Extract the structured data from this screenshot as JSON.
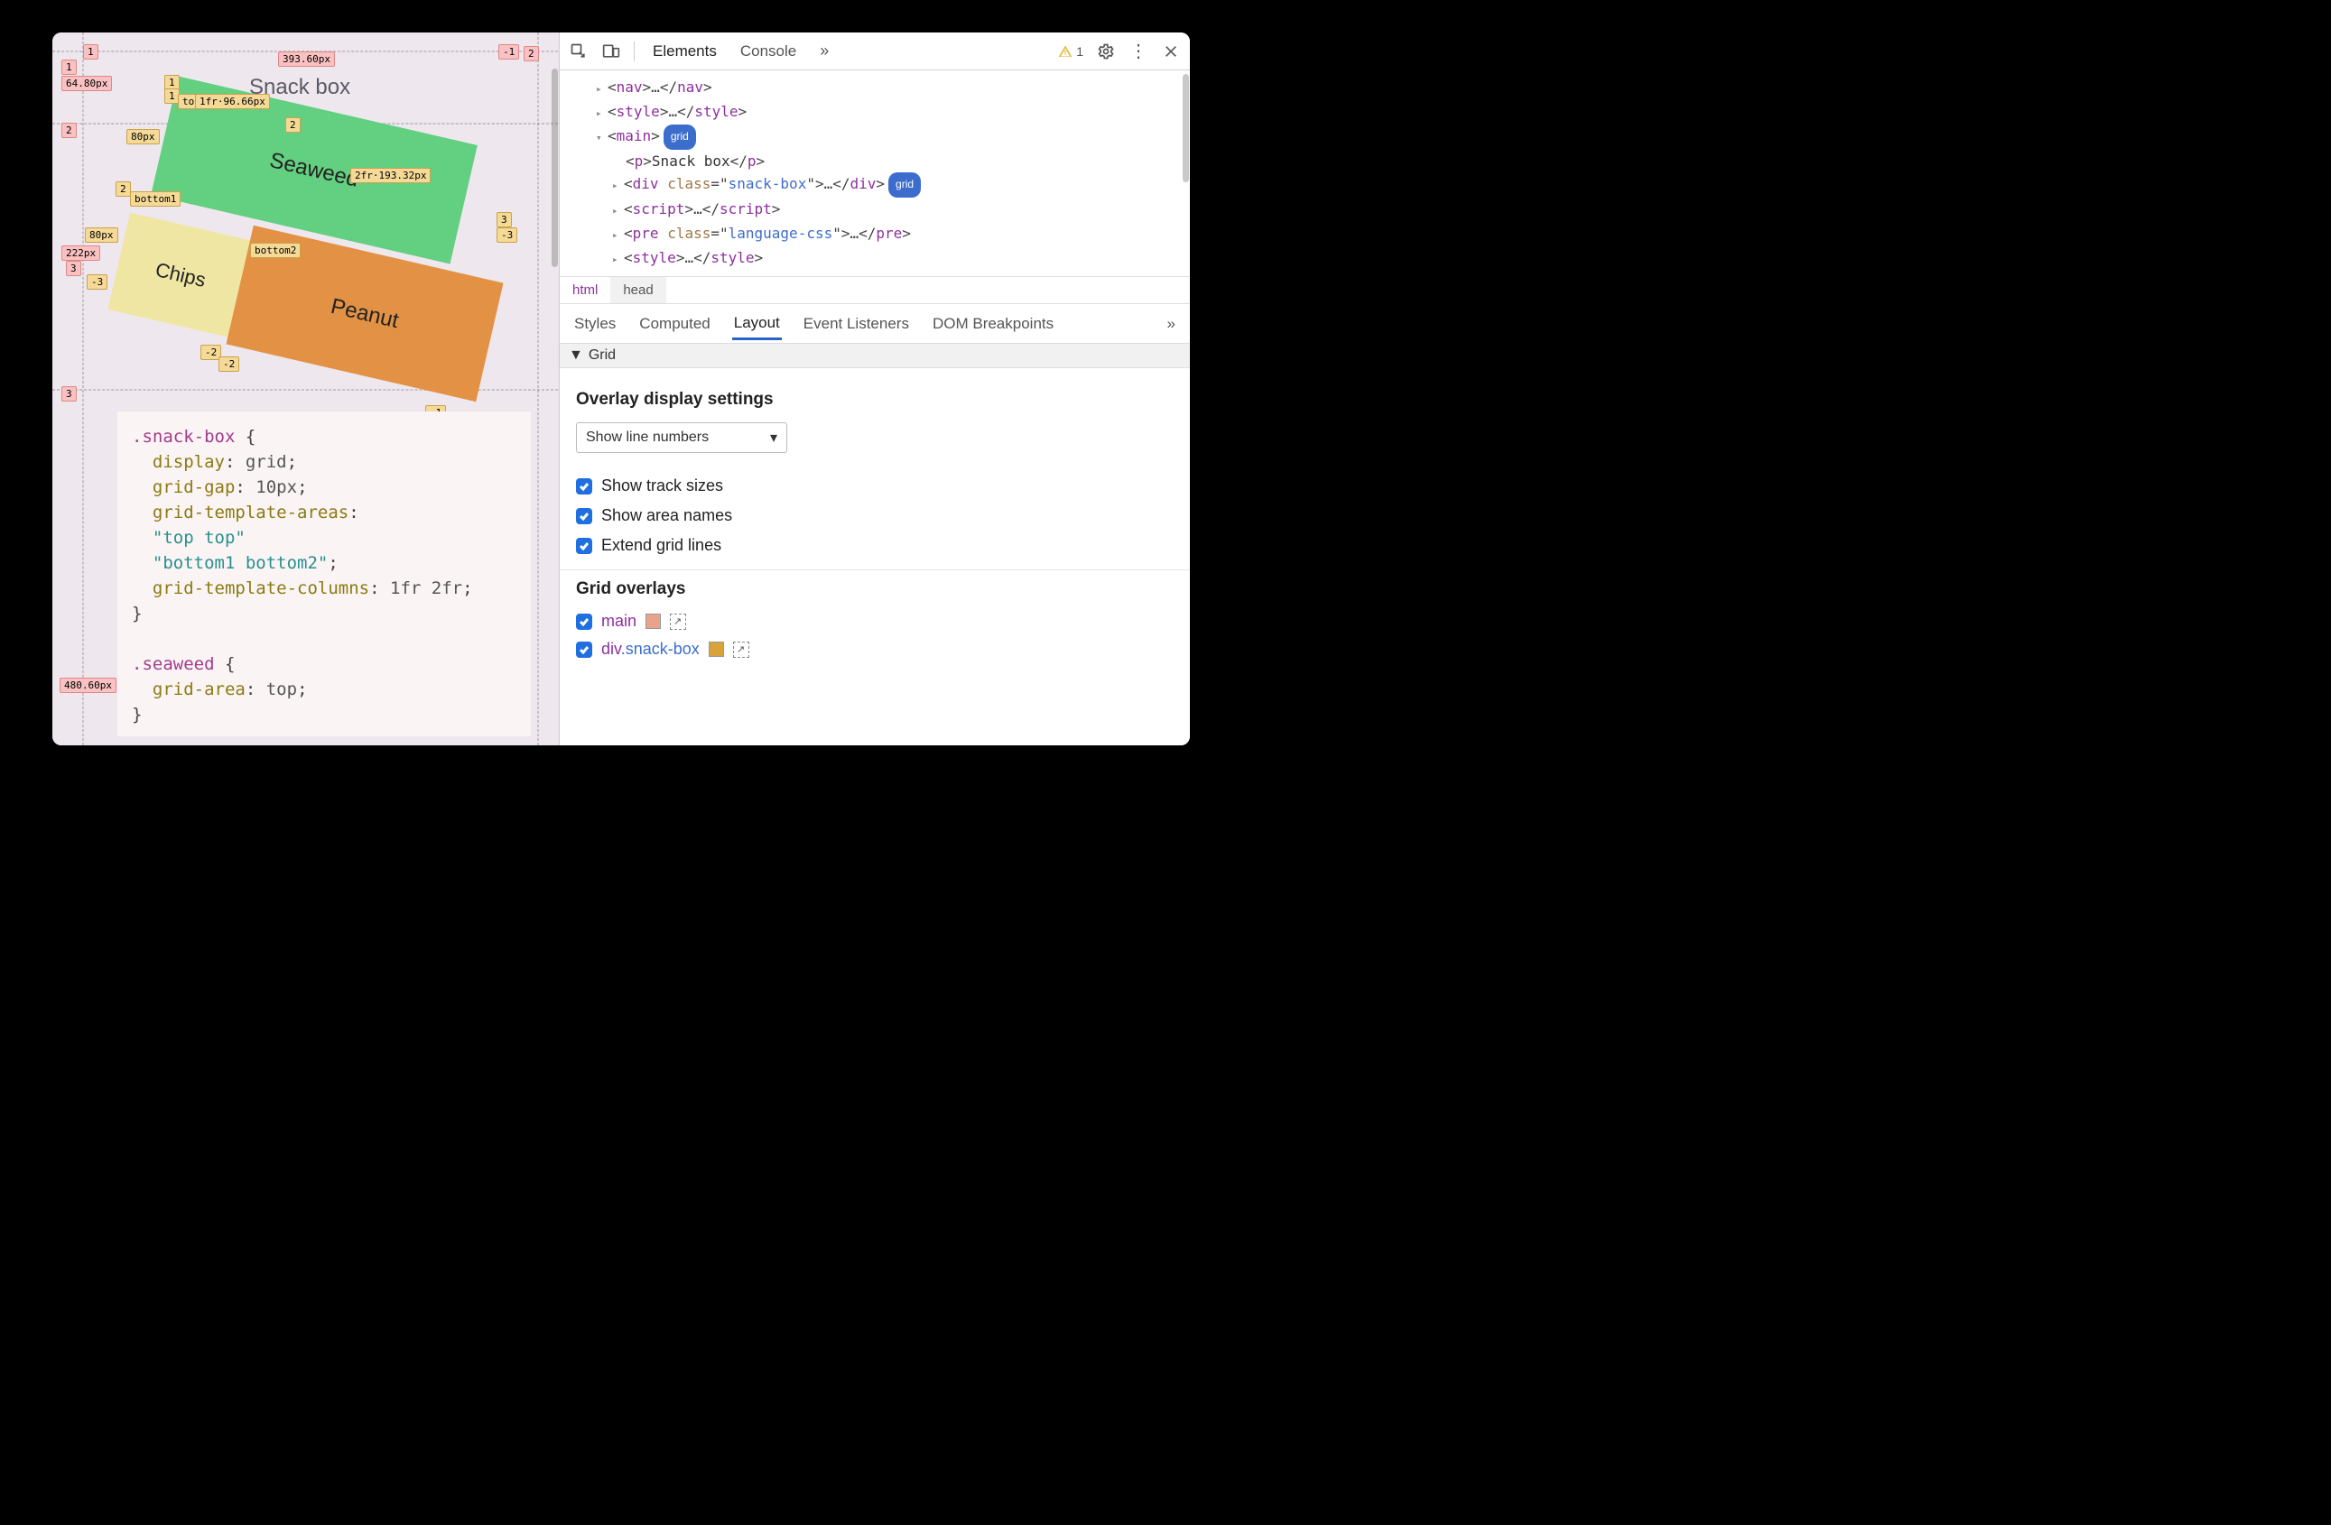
{
  "viewport": {
    "title": "Snack box",
    "boxes": {
      "seaweed": "Seaweed",
      "chips": "Chips",
      "peanut": "Peanut"
    },
    "labels": {
      "top_pink_1": "1",
      "top_px": "393.60px",
      "top_neg1": "-1",
      "top_pink_2": "2",
      "left_pink_1": "1",
      "left_64": "64.80px",
      "left_pink_2": "2",
      "left_80a": "80px",
      "left_pink_neg2a": "2",
      "left_80b": "80px",
      "left_222": "222px",
      "left_pink_3a": "3",
      "left_neg3a": "-3",
      "left_pink_3": "3",
      "left_480": "480.60px",
      "g1a": "1",
      "g1b": "1",
      "toplbl": "top",
      "track1": "1fr·96.66px",
      "g2a": "2",
      "track2": "2fr·193.32px",
      "g3a": "3",
      "neg3b": "-3",
      "bottom1": "bottom1",
      "bottom2": "bottom2",
      "neg2a": "-2",
      "neg2b": "-2",
      "neg1a": "-1",
      "neg1b": "-1"
    },
    "code_lines": [
      {
        "t": "sel",
        "v": ".snack-box"
      },
      {
        "t": "open",
        "v": " {"
      },
      {
        "indent": 1,
        "prop": "display",
        "val": "grid"
      },
      {
        "indent": 1,
        "prop": "grid-gap",
        "val": "10px"
      },
      {
        "indent": 1,
        "prop": "grid-template-areas",
        "val": null
      },
      {
        "indent": 1,
        "str": "\"top top\""
      },
      {
        "indent": 1,
        "str": "\"bottom1 bottom2\"",
        "semi": true
      },
      {
        "indent": 1,
        "prop": "grid-template-columns",
        "val": "1fr 2fr"
      },
      {
        "t": "close",
        "v": "}"
      },
      {
        "blank": true
      },
      {
        "t": "sel",
        "v": ".seaweed"
      },
      {
        "t": "open",
        "v": " {"
      },
      {
        "indent": 1,
        "prop": "grid-area",
        "val": "top"
      },
      {
        "t": "close",
        "v": "}"
      }
    ]
  },
  "devtools": {
    "tabs": {
      "elements": "Elements",
      "console": "Console"
    },
    "warn_count": "1",
    "dom": {
      "nav": "nav",
      "style": "style",
      "main": "main",
      "main_badge": "grid",
      "p_text": "Snack box",
      "div_class": "snack-box",
      "div_badge": "grid",
      "script": "script",
      "pre_class": "language-css",
      "style2": "style"
    },
    "crumbs": {
      "html": "html",
      "head": "head"
    },
    "subtabs": {
      "styles": "Styles",
      "computed": "Computed",
      "layout": "Layout",
      "event": "Event Listeners",
      "dom": "DOM Breakpoints"
    },
    "section_grid": "Grid",
    "overlay_settings_title": "Overlay display settings",
    "select_label": "Show line numbers",
    "checks": {
      "track": "Show track sizes",
      "area": "Show area names",
      "extend": "Extend grid lines"
    },
    "grid_overlays_title": "Grid overlays",
    "overlays": {
      "main_name": "main",
      "div_name": "div",
      "div_cls": ".snack-box"
    },
    "swatches": {
      "main": "#e9a38a",
      "div": "#d9a23a"
    }
  }
}
